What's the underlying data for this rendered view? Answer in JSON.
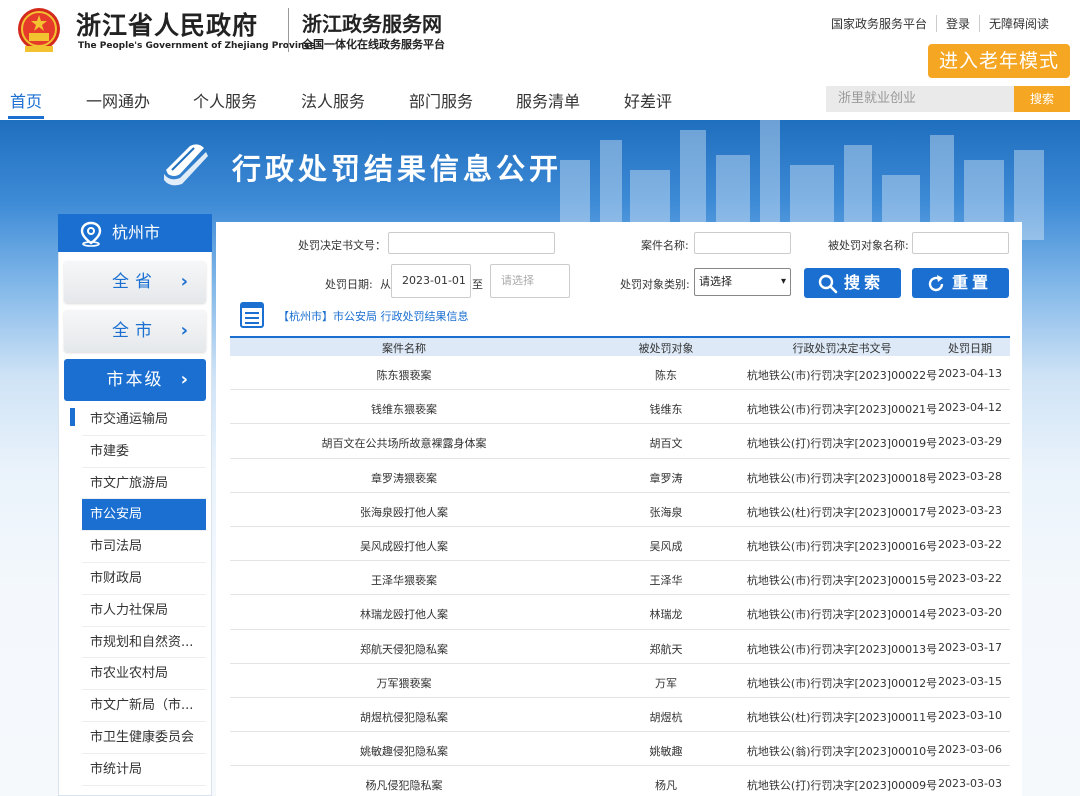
{
  "header": {
    "brand_cn": "浙江省人民政府",
    "brand_en": "The People's Government of Zhejiang Province",
    "site_cn": "浙江政务服务网",
    "site_sub": "全国一体化在线政务服务平台",
    "top_links": [
      "国家政务服务平台",
      "登录",
      "无障碍阅读"
    ],
    "elder_mode": "进入老年模式"
  },
  "nav": {
    "items": [
      "首页",
      "一网通办",
      "个人服务",
      "法人服务",
      "部门服务",
      "服务清单",
      "好差评"
    ],
    "active": "首页",
    "search_placeholder": "浙里就业创业",
    "search_button": "搜索"
  },
  "banner": {
    "title": "行政处罚结果信息公开"
  },
  "sidebar": {
    "city": "杭州市",
    "tabs": [
      "全省",
      "全市",
      "市本级"
    ],
    "departments": [
      "市交通运输局",
      "市建委",
      "市文广旅游局",
      "市公安局",
      "市司法局",
      "市财政局",
      "市人力社保局",
      "市规划和自然资...",
      "市农业农村局",
      "市文广新局（市...",
      "市卫生健康委员会",
      "市统计局"
    ],
    "active_department": "市公安局"
  },
  "filters": {
    "doc_no_label": "处罚决定书文号：",
    "case_name_label": "案件名称:",
    "target_name_label": "被处罚对象名称:",
    "date_label": "处罚日期:",
    "from": "从",
    "to": "至",
    "date_start": "2023-01-01",
    "date_end_placeholder": "请选择",
    "category_label": "处罚对象类别:",
    "category_value": "请选择",
    "search_button": "搜索",
    "reset_button": "重置"
  },
  "breadcrumb": "【杭州市】市公安局 行政处罚结果信息",
  "table": {
    "columns": [
      "案件名称",
      "被处罚对象",
      "行政处罚决定书文号",
      "处罚日期"
    ],
    "rows": [
      [
        "陈东猥亵案",
        "陈东",
        "杭地铁公(市)行罚决字[2023]00022号",
        "2023-04-13"
      ],
      [
        "钱维东猥亵案",
        "钱维东",
        "杭地铁公(市)行罚决字[2023]00021号",
        "2023-04-12"
      ],
      [
        "胡百文在公共场所故意裸露身体案",
        "胡百文",
        "杭地铁公(打)行罚决字[2023]00019号",
        "2023-03-29"
      ],
      [
        "章罗涛猥亵案",
        "章罗涛",
        "杭地铁公(市)行罚决字[2023]00018号",
        "2023-03-28"
      ],
      [
        "张海泉殴打他人案",
        "张海泉",
        "杭地铁公(杜)行罚决字[2023]00017号",
        "2023-03-23"
      ],
      [
        "吴风成殴打他人案",
        "吴风成",
        "杭地铁公(市)行罚决字[2023]00016号",
        "2023-03-22"
      ],
      [
        "王泽华猥亵案",
        "王泽华",
        "杭地铁公(市)行罚决字[2023]00015号",
        "2023-03-22"
      ],
      [
        "林瑞龙殴打他人案",
        "林瑞龙",
        "杭地铁公(市)行罚决字[2023]00014号",
        "2023-03-20"
      ],
      [
        "郑航天侵犯隐私案",
        "郑航天",
        "杭地铁公(市)行罚决字[2023]00013号",
        "2023-03-17"
      ],
      [
        "万军猥亵案",
        "万军",
        "杭地铁公(市)行罚决字[2023]00012号",
        "2023-03-15"
      ],
      [
        "胡煜杭侵犯隐私案",
        "胡煜杭",
        "杭地铁公(杜)行罚决字[2023]00011号",
        "2023-03-10"
      ],
      [
        "姚敏趣侵犯隐私案",
        "姚敏趣",
        "杭地铁公(翁)行罚决字[2023]00010号",
        "2023-03-06"
      ],
      [
        "杨凡侵犯隐私案",
        "杨凡",
        "杭地铁公(打)行罚决字[2023]00009号",
        "2023-03-03"
      ]
    ]
  },
  "colors": {
    "primary": "#1a6fd1",
    "accent": "#f5a623"
  },
  "icons": [
    "national-emblem-icon",
    "book-icon",
    "location-pin-icon",
    "chevron-right-icon",
    "search-icon",
    "refresh-icon",
    "document-list-icon"
  ]
}
